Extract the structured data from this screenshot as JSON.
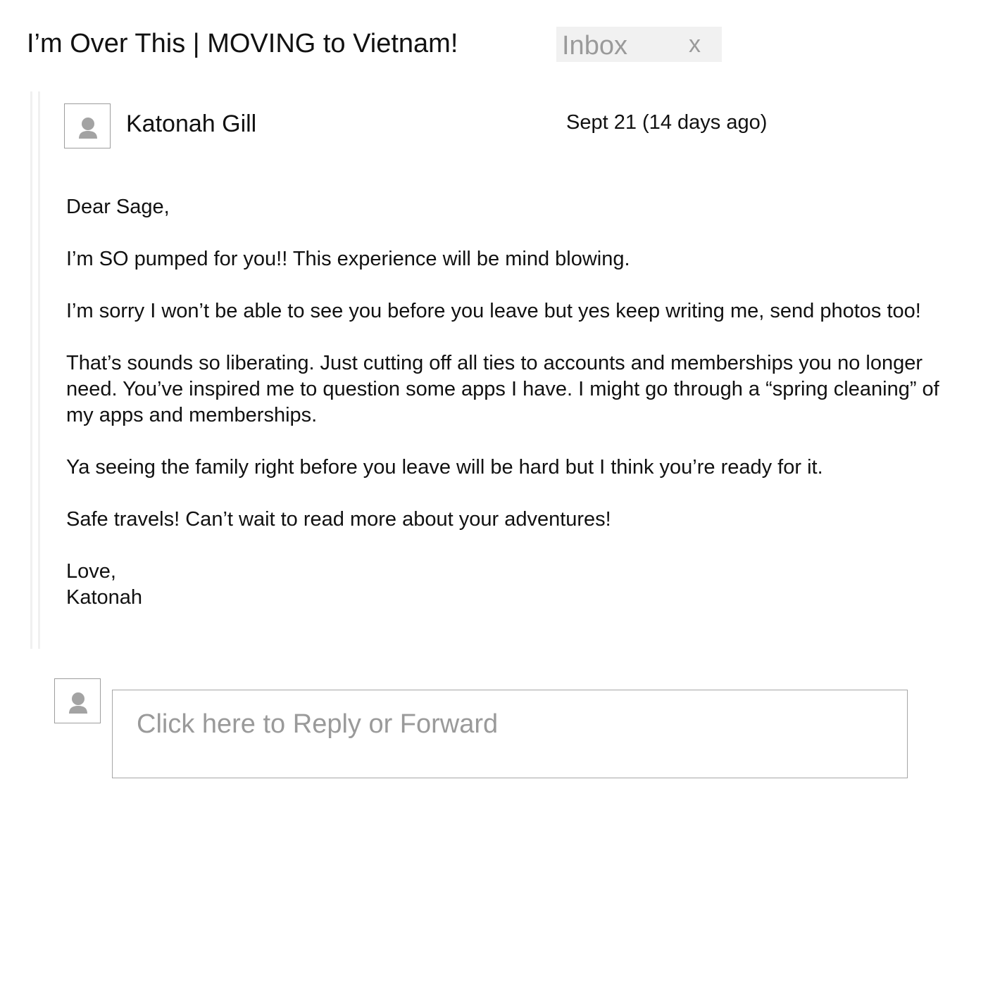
{
  "email": {
    "subject": "I’m Over This |  MOVING to Vietnam!",
    "label": {
      "name": "Inbox",
      "remove_glyph": "x"
    }
  },
  "message": {
    "sender_name": "Katonah Gill",
    "avatar_icon": "person-silhouette-icon",
    "date": "Sept 21 (14 days ago)",
    "greeting": "Dear Sage,",
    "paragraphs": [
      "I’m SO pumped for you!! This experience will be mind blowing.",
      "I’m sorry I won’t be able to see you before you leave but yes keep writing me, send photos too!",
      "That’s sounds so liberating. Just cutting off all ties to accounts and memberships you no longer need. You’ve inspired me to question some apps I have. I might go through a “spring cleaning” of my apps and memberships.",
      "Ya seeing the family right before you leave will be hard but I think you’re ready for it.",
      "Safe travels! Can’t wait to read more about your adventures!"
    ],
    "signoff": "Love,",
    "signature": "Katonah"
  },
  "reply": {
    "avatar_icon": "person-silhouette-icon",
    "placeholder": "Click here to Reply or Forward"
  },
  "colors": {
    "label_bg": "#f1f1f1",
    "muted_text": "#9a9a9a",
    "border": "#a6a6a6",
    "avatar_fill": "#a3a3a3"
  }
}
